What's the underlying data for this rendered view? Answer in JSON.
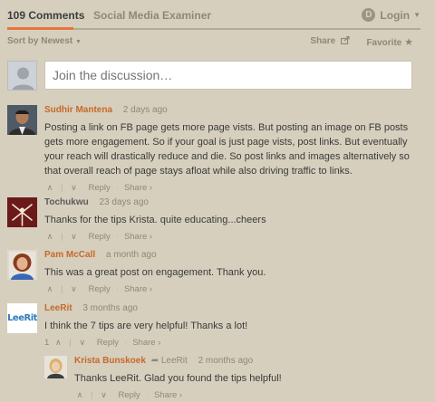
{
  "header": {
    "comments_tab": "109 Comments",
    "forum_tab": "Social Media Examiner",
    "login": "Login"
  },
  "sortbar": {
    "sort": "Sort by Newest",
    "share": "Share",
    "favorite": "Favorite"
  },
  "composer": {
    "placeholder": "Join the discussion…"
  },
  "comments": [
    {
      "author": "Sudhir Mantena",
      "time": "2 days ago",
      "text": "Posting a link on FB page gets more page vists. But posting an image on FB posts gets more engagement. So if your goal is just page vists, post links. But eventually your reach will drastically reduce and die. So post links and images alternatively so that overall reach of page stays afloat while also driving traffic to links.",
      "reply": "Reply",
      "share": "Share ›"
    },
    {
      "author": "Tochukwu",
      "time": "23 days ago",
      "text": "Thanks for the tips Krista. quite educating...cheers",
      "reply": "Reply",
      "share": "Share ›"
    },
    {
      "author": "Pam McCall",
      "time": "a month ago",
      "text": "This was a great post on engagement. Thank you.",
      "reply": "Reply",
      "share": "Share ›"
    },
    {
      "author": "LeeRit",
      "time": "3 months ago",
      "text": "I think the 7 tips are very helpful! Thanks a lot!",
      "votes": "1",
      "reply": "Reply",
      "share": "Share ›",
      "avatar_text": "LeeRit"
    },
    {
      "author": "Krista Bunskoek",
      "reply_to": "LeeRit",
      "time": "2 months ago",
      "text": "Thanks LeeRit. Glad you found the tips helpful!",
      "reply": "Reply",
      "share": "Share ›"
    }
  ],
  "icons": {
    "disqus": "disqus-icon",
    "share": "share-icon",
    "favorite": "star-icon"
  },
  "colors": {
    "background": "#d6cfbd",
    "accent": "#e8743b",
    "author": "#c6692b"
  }
}
